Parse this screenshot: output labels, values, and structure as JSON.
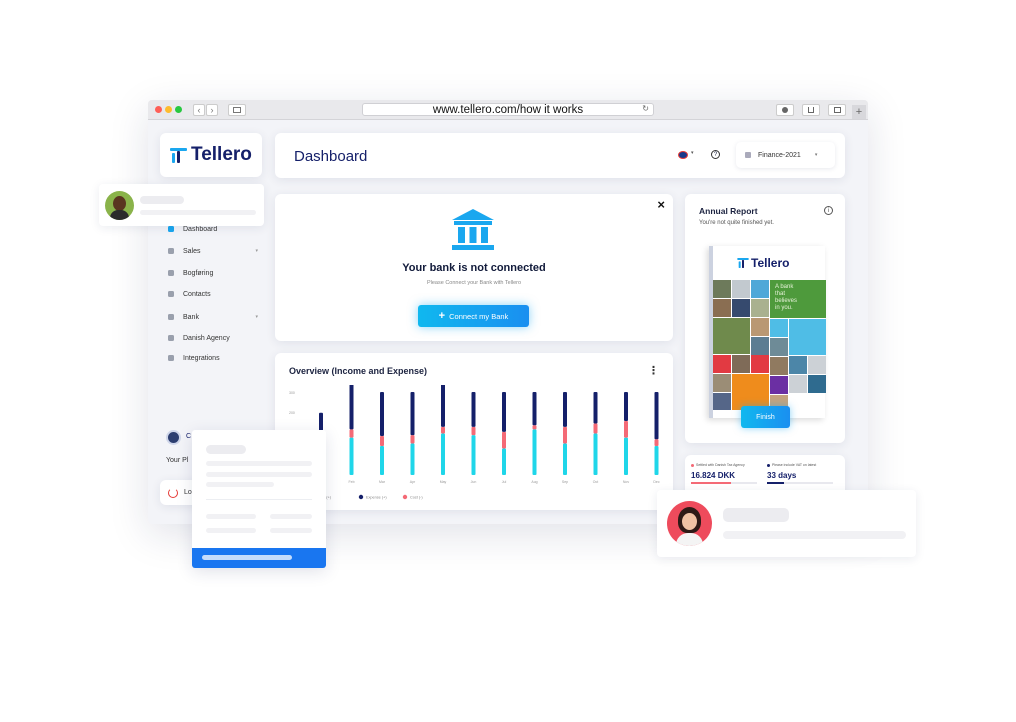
{
  "browser": {
    "url": "www.tellero.com/how it works",
    "new_tab_glyph": "+"
  },
  "brand": {
    "logo_text": "Tellero",
    "accent": "#1aa7ef",
    "navy": "#15206a"
  },
  "header": {
    "title": "Dashboard",
    "company_select": "Finance-2021"
  },
  "sidebar": {
    "items": [
      {
        "label": "Dashboard",
        "icon": "dashboard-icon",
        "active": true
      },
      {
        "label": "Sales",
        "icon": "sales-icon",
        "has_chevron": true
      },
      {
        "label": "Bogføring",
        "icon": "ledger-icon"
      },
      {
        "label": "Contacts",
        "icon": "contacts-icon"
      },
      {
        "label": "Bank",
        "icon": "bank-icon",
        "has_chevron": true
      },
      {
        "label": "Danish Agency",
        "icon": "mail-icon"
      },
      {
        "label": "Integrations",
        "icon": "integrations-icon"
      }
    ],
    "user_initial": "C",
    "plan_label": "Your Pl",
    "logout_label": "Lo"
  },
  "bank_card": {
    "close": "×",
    "title": "Your bank is not connected",
    "subtitle": "Please Connect your Bank with Tellero",
    "button": "Connect my Bank",
    "button_icon": "+"
  },
  "overview": {
    "title": "Overview (Income and Expense)",
    "menu": "⋮"
  },
  "chart_data": {
    "type": "bar",
    "categories": [
      "Jan",
      "Feb",
      "Mar",
      "Apr",
      "May",
      "Jun",
      "Jul",
      "Aug",
      "Sep",
      "Oct",
      "Nov",
      "Dec"
    ],
    "y_ticks": [
      "300",
      "200"
    ],
    "series": [
      {
        "name": "Revenue (+)",
        "color": "#1fd6e9",
        "values": [
          0.25,
          0.45,
          0.35,
          0.38,
          0.5,
          0.48,
          0.32,
          0.55,
          0.38,
          0.5,
          0.45,
          0.35
        ]
      },
      {
        "name": "Cost (-)",
        "color": "#f46a76",
        "values": [
          0.05,
          0.1,
          0.12,
          0.1,
          0.08,
          0.1,
          0.2,
          0.05,
          0.2,
          0.12,
          0.2,
          0.08
        ]
      },
      {
        "name": "Expense (+)",
        "color": "#15206a",
        "values": [
          0.45,
          0.55,
          0.53,
          0.52,
          0.52,
          0.42,
          0.48,
          0.4,
          0.42,
          0.38,
          0.35,
          0.57
        ]
      }
    ],
    "legend": [
      "Revenue (+)",
      "Expense (+)",
      "Cost (-)"
    ],
    "legend_colors": [
      "#1fd6e9",
      "#15206a",
      "#f46a76"
    ]
  },
  "annual_report": {
    "title": "Annual Report",
    "subtitle": "You're not quite finished yet.",
    "book_logo": "Tellero",
    "book_tagline": [
      "A bank",
      "that",
      "believes",
      "in you."
    ],
    "button": "Finish"
  },
  "stats": [
    {
      "label": "Settled with Danish Tax Agency",
      "value": "16.824 DKK",
      "dot": "#f46a76"
    },
    {
      "label": "Please include VAT on latest",
      "value": "33 days",
      "dot": "#15206a"
    }
  ]
}
